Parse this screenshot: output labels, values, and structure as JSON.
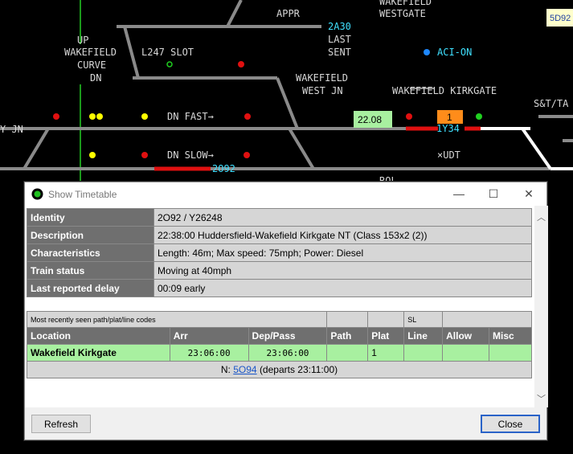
{
  "sim": {
    "labels": {
      "up": "UP",
      "wakefield_curve_1": "WAKEFIELD",
      "wakefield_curve_2": "CURVE",
      "dn": "DN",
      "l247_slot": "L247 SLOT",
      "appr": "APPR",
      "headcode_2a30": "2A30",
      "last": "LAST",
      "sent": "SENT",
      "wakefield_westgate_1": "WAKEFIELD",
      "wakefield_westgate_2": "WESTGATE",
      "aci_on": "ACI-ON",
      "wakefield_west_jn_1": "WAKEFIELD",
      "wakefield_west_jn_2": "WEST JN",
      "wakefield_kirkgate": "WAKEFIELD KIRKGATE",
      "st_tag": "S&T/TA",
      "y_jn": "Y JN",
      "dn_fast": "DN FAST→",
      "dn_slow": "DN SLOW→",
      "headcode_2o92": "2O92",
      "clock": "22.08",
      "platform_1": "1",
      "headcode_1y34": "1Y34",
      "x_udt": "×UDT",
      "rol": "ROL",
      "corner_tag": "5D92"
    }
  },
  "dialog": {
    "title": "Show Timetable",
    "info": [
      {
        "label": "Identity",
        "value": "2O92 / Y26248"
      },
      {
        "label": "Description",
        "value": "22:38:00 Huddersfield-Wakefield Kirkgate NT (Class 153x2 (2))"
      },
      {
        "label": "Characteristics",
        "value": "Length: 46m; Max speed: 75mph; Power: Diesel"
      },
      {
        "label": "Train status",
        "value": "Moving at 40mph"
      },
      {
        "label": "Last reported delay",
        "value": "00:09 early"
      }
    ],
    "timetable": {
      "recent_label": "Most recently seen path/plat/line codes",
      "sl_label": "SL",
      "headers": [
        "Location",
        "Arr",
        "Dep/Pass",
        "Path",
        "Plat",
        "Line",
        "Allow",
        "Misc"
      ],
      "rows": [
        {
          "location": "Wakefield Kirkgate",
          "arr": "23:06:00",
          "dep": "23:06:00",
          "path": "",
          "plat": "1",
          "line": "",
          "allow": "",
          "misc": ""
        }
      ],
      "next_prefix": "N:",
      "next_headcode": "5O94",
      "next_suffix": "(departs 23:11:00)"
    },
    "buttons": {
      "refresh": "Refresh",
      "close": "Close"
    }
  }
}
